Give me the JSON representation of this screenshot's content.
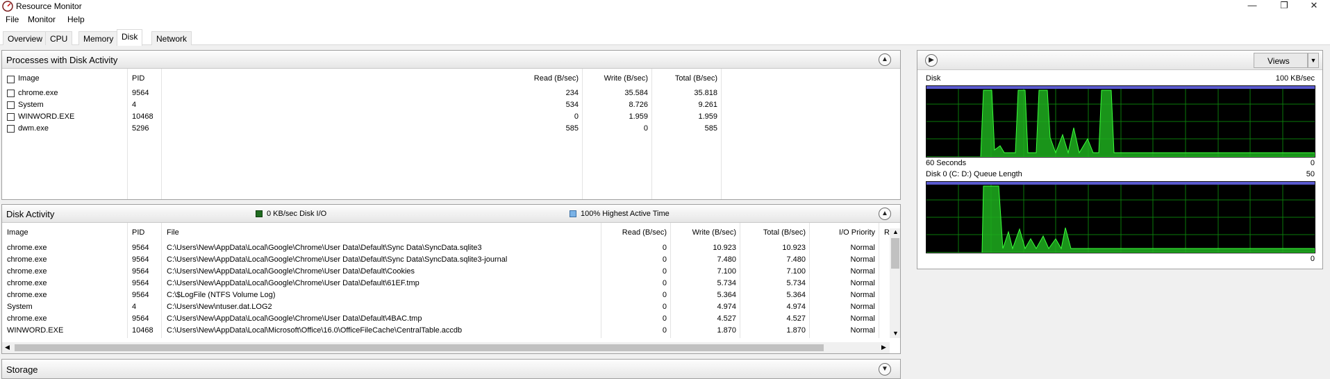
{
  "window": {
    "title": "Resource Monitor",
    "minimize_icon": "minimize-icon",
    "maximize_icon": "restore-icon",
    "close_icon": "close-icon"
  },
  "menu": [
    "File",
    "Monitor",
    "Help"
  ],
  "tabs": [
    "Overview",
    "CPU",
    "Memory",
    "Disk",
    "Network"
  ],
  "active_tab": "Disk",
  "processes": {
    "title": "Processes with Disk Activity",
    "columns": {
      "image": "Image",
      "pid": "PID",
      "read": "Read (B/sec)",
      "write": "Write (B/sec)",
      "total": "Total (B/sec)"
    },
    "rows": [
      {
        "image": "chrome.exe",
        "pid": "9564",
        "read": "234",
        "write": "35.584",
        "total": "35.818"
      },
      {
        "image": "System",
        "pid": "4",
        "read": "534",
        "write": "8.726",
        "total": "9.261"
      },
      {
        "image": "WINWORD.EXE",
        "pid": "10468",
        "read": "0",
        "write": "1.959",
        "total": "1.959"
      },
      {
        "image": "dwm.exe",
        "pid": "5296",
        "read": "585",
        "write": "0",
        "total": "585"
      }
    ]
  },
  "disk_activity": {
    "title": "Disk Activity",
    "io_legend": "0 KB/sec Disk I/O",
    "active_legend": "100% Highest Active Time",
    "io_color": "#1f6b1f",
    "active_color": "#7ab2e6",
    "columns": {
      "image": "Image",
      "pid": "PID",
      "file": "File",
      "read": "Read (B/sec)",
      "write": "Write (B/sec)",
      "total": "Total (B/sec)",
      "priority": "I/O Priority",
      "response": "R"
    },
    "rows": [
      {
        "image": "chrome.exe",
        "pid": "9564",
        "file": "C:\\Users\\New\\AppData\\Local\\Google\\Chrome\\User Data\\Default\\Sync Data\\SyncData.sqlite3",
        "read": "0",
        "write": "10.923",
        "total": "10.923",
        "priority": "Normal"
      },
      {
        "image": "chrome.exe",
        "pid": "9564",
        "file": "C:\\Users\\New\\AppData\\Local\\Google\\Chrome\\User Data\\Default\\Sync Data\\SyncData.sqlite3-journal",
        "read": "0",
        "write": "7.480",
        "total": "7.480",
        "priority": "Normal"
      },
      {
        "image": "chrome.exe",
        "pid": "9564",
        "file": "C:\\Users\\New\\AppData\\Local\\Google\\Chrome\\User Data\\Default\\Cookies",
        "read": "0",
        "write": "7.100",
        "total": "7.100",
        "priority": "Normal"
      },
      {
        "image": "chrome.exe",
        "pid": "9564",
        "file": "C:\\Users\\New\\AppData\\Local\\Google\\Chrome\\User Data\\Default\\61EF.tmp",
        "read": "0",
        "write": "5.734",
        "total": "5.734",
        "priority": "Normal"
      },
      {
        "image": "chrome.exe",
        "pid": "9564",
        "file": "C:\\$LogFile (NTFS Volume Log)",
        "read": "0",
        "write": "5.364",
        "total": "5.364",
        "priority": "Normal"
      },
      {
        "image": "System",
        "pid": "4",
        "file": "C:\\Users\\New\\ntuser.dat.LOG2",
        "read": "0",
        "write": "4.974",
        "total": "4.974",
        "priority": "Normal"
      },
      {
        "image": "chrome.exe",
        "pid": "9564",
        "file": "C:\\Users\\New\\AppData\\Local\\Google\\Chrome\\User Data\\Default\\4BAC.tmp",
        "read": "0",
        "write": "4.527",
        "total": "4.527",
        "priority": "Normal"
      },
      {
        "image": "WINWORD.EXE",
        "pid": "10468",
        "file": "C:\\Users\\New\\AppData\\Local\\Microsoft\\Office\\16.0\\OfficeFileCache\\CentralTable.accdb",
        "read": "0",
        "write": "1.870",
        "total": "1.870",
        "priority": "Normal"
      }
    ]
  },
  "storage": {
    "title": "Storage"
  },
  "graphs": {
    "views_label": "Views",
    "disk": {
      "title": "Disk",
      "max_label": "100 KB/sec",
      "time_label": "60 Seconds",
      "min_label": "0"
    },
    "queue": {
      "title": "Disk 0 (C: D:) Queue Length",
      "max_label": "50",
      "min_label": "0"
    }
  }
}
